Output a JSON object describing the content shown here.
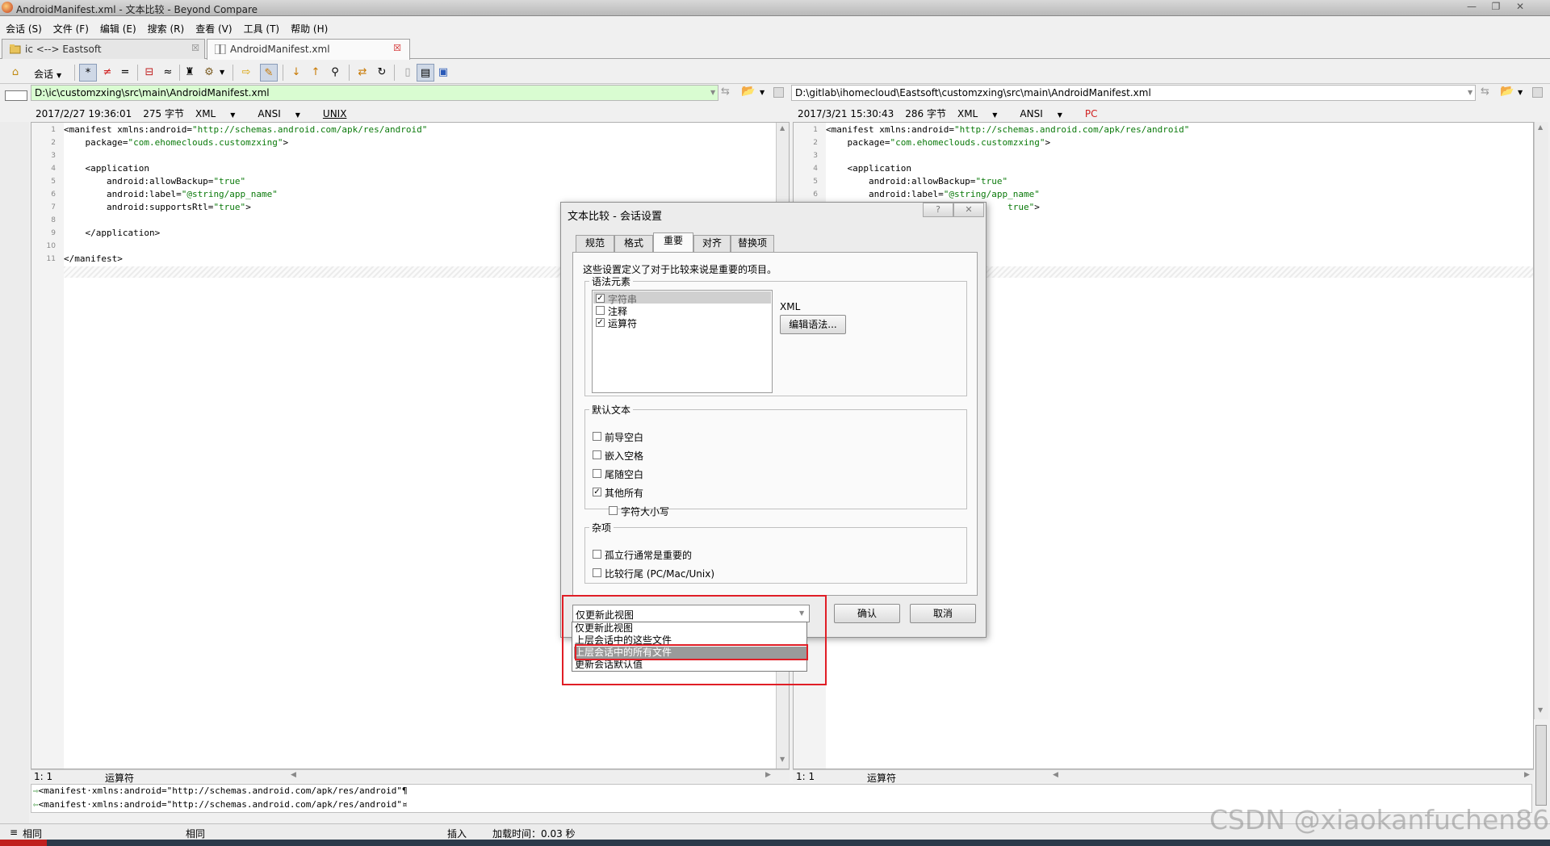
{
  "window": {
    "title": "AndroidManifest.xml - 文本比较 - Beyond Compare"
  },
  "menu": [
    "会话 (S)",
    "文件 (F)",
    "编辑 (E)",
    "搜索 (R)",
    "查看 (V)",
    "工具 (T)",
    "帮助 (H)"
  ],
  "tabs": [
    {
      "label": "ic <--> Eastsoft",
      "active": false
    },
    {
      "label": "AndroidManifest.xml",
      "active": true
    }
  ],
  "toolbar": {
    "session_label": "会话"
  },
  "left": {
    "path": "D:\\ic\\customzxing\\src\\main\\AndroidManifest.xml",
    "date": "2017/2/27 19:36:01",
    "size": "275 字节",
    "format": "XML",
    "encoding": "ANSI",
    "eol": "UNIX",
    "lines": [
      {
        "n": "1",
        "t": "<manifest xmlns:android=",
        "s": "\"http://schemas.android.com/apk/res/android\""
      },
      {
        "n": "2",
        "t": "    package=",
        "s": "\"com.ehomeclouds.customzxing\"",
        "e": ">"
      },
      {
        "n": "3",
        "t": ""
      },
      {
        "n": "4",
        "t": "    <application"
      },
      {
        "n": "5",
        "t": "        android:allowBackup=",
        "s": "\"true\""
      },
      {
        "n": "6",
        "t": "        android:label=",
        "s": "\"@string/app_name\""
      },
      {
        "n": "7",
        "t": "        android:supportsRtl=",
        "s": "\"true\"",
        "e": ">"
      },
      {
        "n": "8",
        "t": ""
      },
      {
        "n": "9",
        "t": "    </application>"
      },
      {
        "n": "10",
        "t": ""
      },
      {
        "n": "11",
        "t": "</manifest>"
      }
    ],
    "pos": "1: 1",
    "mode": "运算符"
  },
  "right": {
    "path": "D:\\gitlab\\ihomecloud\\Eastsoft\\customzxing\\src\\main\\AndroidManifest.xml",
    "date": "2017/3/21 15:30:43",
    "size": "286 字节",
    "format": "XML",
    "encoding": "ANSI",
    "eol": "PC",
    "lines": [
      {
        "n": "1",
        "t": "<manifest xmlns:android=",
        "s": "\"http://schemas.android.com/apk/res/android\""
      },
      {
        "n": "2",
        "t": "    package=",
        "s": "\"com.ehomeclouds.customzxing\"",
        "e": ">"
      },
      {
        "n": "3",
        "t": ""
      },
      {
        "n": "4",
        "t": "    <application"
      },
      {
        "n": "5",
        "t": "        android:allowBackup=",
        "s": "\"true\""
      },
      {
        "n": "6",
        "t": "        android:label=",
        "s": "\"@string/app_name\""
      },
      {
        "n": "7",
        "t": "                                  ",
        "s": "true\"",
        "e": ">"
      }
    ],
    "pos": "1: 1",
    "mode": "运算符"
  },
  "bottom_lines": [
    "<manifest·xmlns:android=\"http://schemas.android.com/apk/res/android\"¶",
    "<manifest·xmlns:android=\"http://schemas.android.com/apk/res/android\"¤"
  ],
  "statusbar": {
    "left_label": "相同",
    "mid_label": "相同",
    "insert": "插入",
    "load_time": "加载时间：0.03 秒"
  },
  "dialog": {
    "title": "文本比较 - 会话设置",
    "help_btn": "?",
    "close_btn": "✕",
    "tabs": [
      "规范",
      "格式",
      "重要",
      "对齐",
      "替换项"
    ],
    "active_tab": "重要",
    "description": "这些设置定义了对于比较来说是重要的项目。",
    "grammar_group": "语法元素",
    "grammar_items": [
      {
        "label": "字符串",
        "checked": true,
        "highlight": true
      },
      {
        "label": "注释",
        "checked": false
      },
      {
        "label": "运算符",
        "checked": true
      }
    ],
    "grammar_type": "XML",
    "edit_grammar_btn": "编辑语法...",
    "default_text_group": "默认文本",
    "default_items": [
      {
        "label": "前导空白",
        "checked": false
      },
      {
        "label": "嵌入空格",
        "checked": false
      },
      {
        "label": "尾随空白",
        "checked": false
      },
      {
        "label": "其他所有",
        "checked": true
      },
      {
        "label": "字符大小写",
        "checked": false
      }
    ],
    "misc_group": "杂项",
    "misc_items": [
      {
        "label": "孤立行通常是重要的",
        "checked": false
      },
      {
        "label": "比较行尾 (PC/Mac/Unix)",
        "checked": false
      }
    ],
    "scope_selected": "仅更新此视图",
    "scope_options": [
      "仅更新此视图",
      "上层会话中的这些文件",
      "上层会话中的所有文件",
      "更新会话默认值"
    ],
    "scope_highlight_index": 2,
    "ok_btn": "确认",
    "cancel_btn": "取消"
  },
  "watermark": "CSDN @xiaokanfuchen86",
  "colors": {
    "left_path_bg": "#d9fcd1",
    "string_green": "#0b7a0b",
    "highlight_red": "#e01e26",
    "eol_red": "#d02020"
  }
}
